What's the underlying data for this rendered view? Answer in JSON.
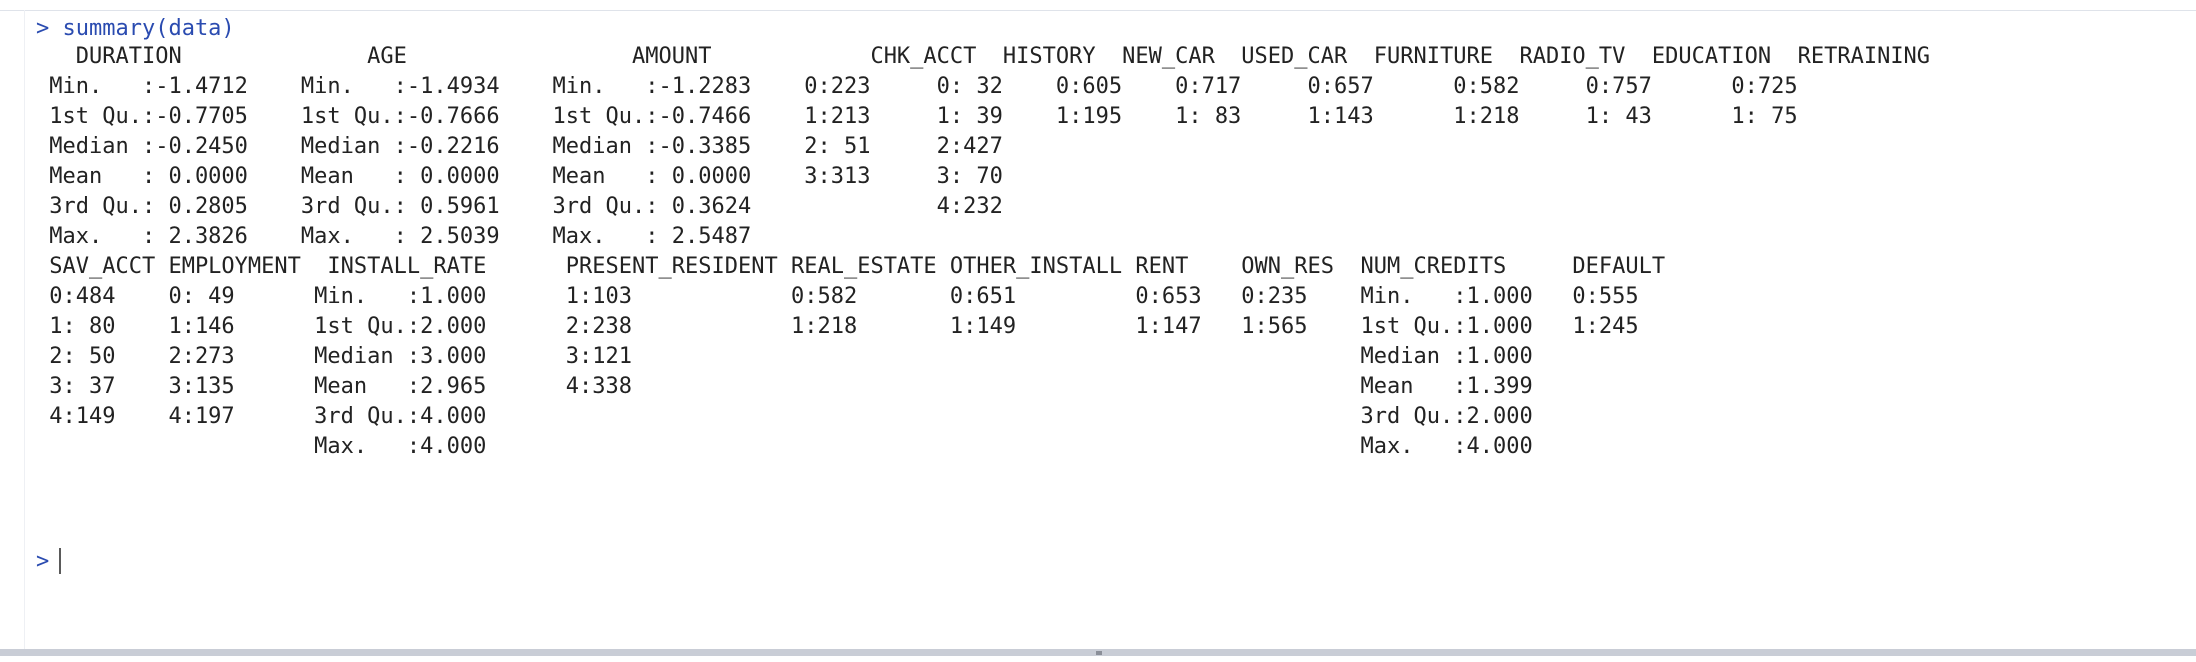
{
  "console": {
    "command_line": "> summary(data)",
    "output_lines": [
      "   DURATION              AGE                 AMOUNT            CHK_ACCT  HISTORY  NEW_CAR  USED_CAR  FURNITURE  RADIO_TV  EDUCATION  RETRAINING",
      " Min.   :-1.4712    Min.   :-1.4934    Min.   :-1.2283    0:223     0: 32    0:605    0:717     0:657      0:582     0:757      0:725",
      " 1st Qu.:-0.7705    1st Qu.:-0.7666    1st Qu.:-0.7466    1:213     1: 39    1:195    1: 83     1:143      1:218     1: 43      1: 75",
      " Median :-0.2450    Median :-0.2216    Median :-0.3385    2: 51     2:427",
      " Mean   : 0.0000    Mean   : 0.0000    Mean   : 0.0000    3:313     3: 70",
      " 3rd Qu.: 0.2805    3rd Qu.: 0.5961    3rd Qu.: 0.3624              4:232",
      " Max.   : 2.3826    Max.   : 2.5039    Max.   : 2.5487",
      " SAV_ACCT EMPLOYMENT  INSTALL_RATE      PRESENT_RESIDENT REAL_ESTATE OTHER_INSTALL RENT    OWN_RES  NUM_CREDITS     DEFAULT",
      " 0:484    0: 49      Min.   :1.000      1:103            0:582       0:651         0:653   0:235    Min.   :1.000   0:555",
      " 1: 80    1:146      1st Qu.:2.000      2:238            1:218       1:149         1:147   1:565    1st Qu.:1.000   1:245",
      " 2: 50    2:273      Median :3.000      3:121                                                       Median :1.000",
      " 3: 37    3:135      Mean   :2.965      4:338                                                       Mean   :1.399",
      " 4:149    4:197      3rd Qu.:4.000                                                                  3rd Qu.:2.000",
      "                     Max.   :4.000                                                                  Max.   :4.000"
    ],
    "prompt": ">"
  },
  "colors": {
    "command": "#2a4bb0",
    "output": "#222222",
    "background": "#ffffff"
  }
}
